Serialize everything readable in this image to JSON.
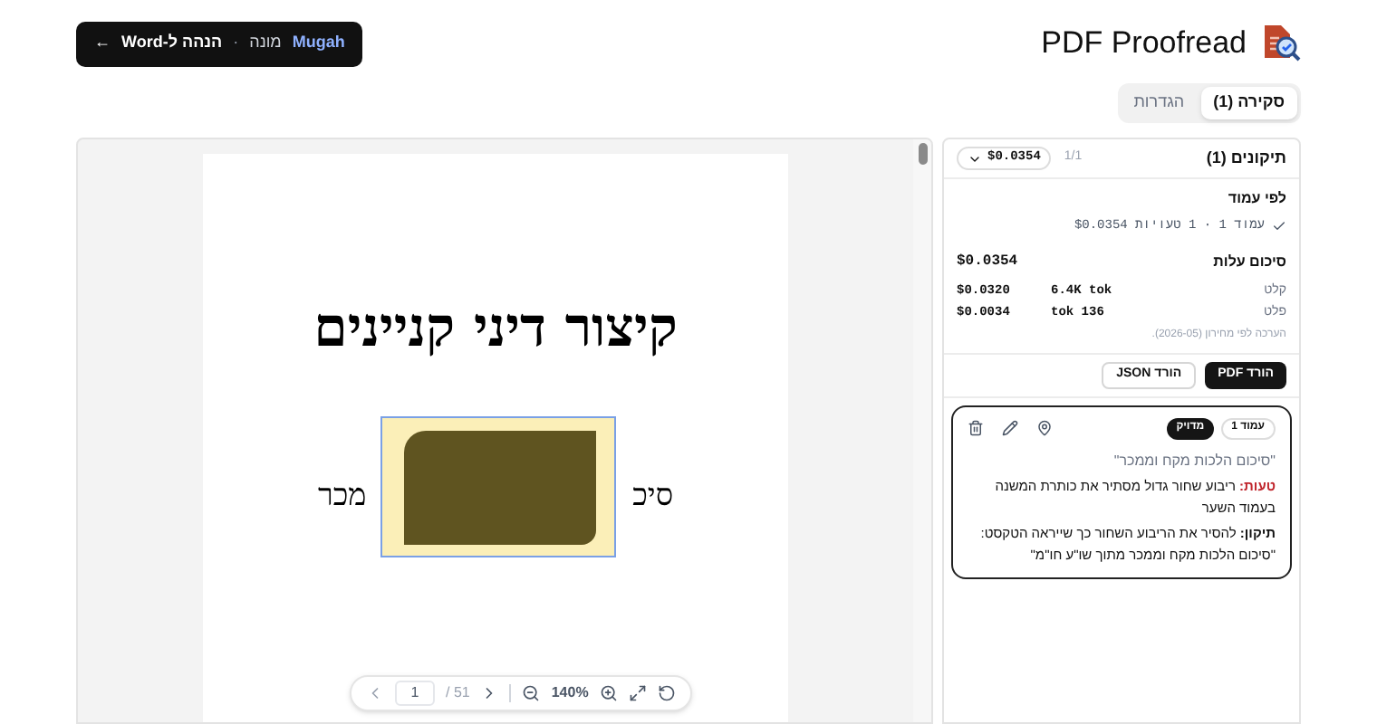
{
  "header": {
    "app_title": "PDF Proofread",
    "back_button": {
      "brand": "Mugah",
      "product": "מונה",
      "separator": "·",
      "label": "הנהה ל-Word",
      "arrow": "←"
    }
  },
  "tabs": [
    {
      "label": "סקירה (1)",
      "selected": true
    },
    {
      "label": "הגדרות",
      "selected": false
    }
  ],
  "viewer": {
    "page": {
      "title": "קיצור דיני קניינים",
      "fragment_right": "סיכ",
      "fragment_left": "מכר"
    },
    "toolbar": {
      "page_input": "1",
      "page_total": "/ 51",
      "zoom": "140%"
    }
  },
  "corrections_panel": {
    "title": "תיקונים (1)",
    "counter": "1/1",
    "cost_dropdown": "$0.0354",
    "by_page": {
      "heading": "לפי עמוד",
      "rows": [
        {
          "checked": true,
          "text": "עמוד 1 · 1 טעויות $0.0354"
        }
      ]
    },
    "cost": {
      "heading": "סיכום עלות",
      "total": "$0.0354",
      "rows": [
        {
          "label": "קלט",
          "tokens": "6.4K tok",
          "price": "$0.0320"
        },
        {
          "label": "פלט",
          "tokens": "tok 136",
          "price": "$0.0034"
        }
      ],
      "note": "הערכה לפי מחירון (2026-05)."
    },
    "downloads": [
      {
        "label": "הורד PDF",
        "kind": "primary"
      },
      {
        "label": "הורד JSON",
        "kind": "secondary"
      }
    ],
    "corrections": [
      {
        "selected": true,
        "page_badge": "עמוד 1",
        "status_badge": "מדויק",
        "quote": "\"סיכום הלכות מקח וממכר\"",
        "error": "**טעות:** ריבוע שחור גדול מסתיר את כותרת המשנה בעמוד השער",
        "fix": "**תיקון:** להסיר את הריבוע השחור כך שייראה הטקסט: \"סיכום הלכות מקח וממכר מתוך שו\"ע חו\"מ\""
      }
    ]
  }
}
